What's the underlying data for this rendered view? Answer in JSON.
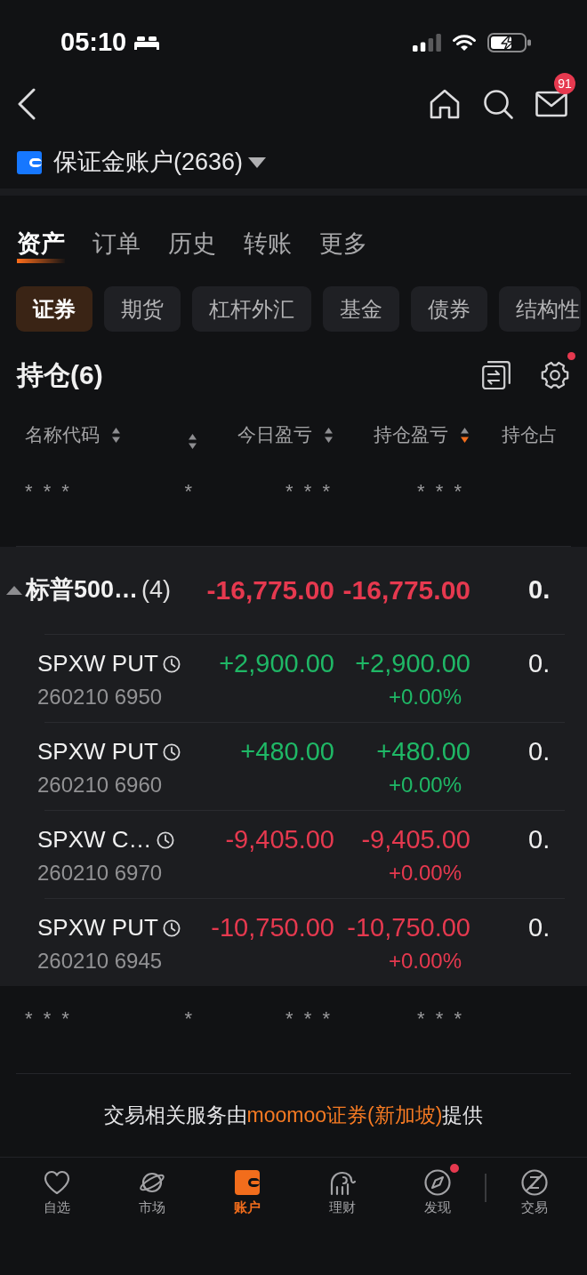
{
  "status_bar": {
    "time": "05:10"
  },
  "nav_bar": {
    "mail_badge": "91"
  },
  "account": {
    "name": "保证金账户(2636)"
  },
  "tabs": [
    {
      "label": "资产",
      "selected": true
    },
    {
      "label": "订单",
      "selected": false
    },
    {
      "label": "历史",
      "selected": false
    },
    {
      "label": "转账",
      "selected": false
    },
    {
      "label": "更多",
      "selected": false
    }
  ],
  "chips": [
    {
      "label": "证券",
      "selected": true
    },
    {
      "label": "期货",
      "selected": false
    },
    {
      "label": "杠杆外汇",
      "selected": false
    },
    {
      "label": "基金",
      "selected": false
    },
    {
      "label": "债券",
      "selected": false
    },
    {
      "label": "结构性",
      "selected": false
    }
  ],
  "holdings": {
    "title": "持仓(6)",
    "settings_dot": true,
    "columns": [
      {
        "label": "名称代码",
        "sort_desc": false
      },
      {
        "sort_desc": false
      },
      {
        "label": "今日盈亏",
        "sort_desc": false
      },
      {
        "label": "持仓盈亏",
        "sort_desc": true
      },
      {
        "label": "持仓占"
      }
    ],
    "masked_summary": {
      "column_1": "* * *",
      "column_2": "*",
      "column_3": "* * *",
      "column_4": "* * *"
    },
    "groups": [
      {
        "expanded": true,
        "name": "标普500…",
        "count": "(4)",
        "today": "-16,775.00",
        "total": "-16,775.00",
        "ratio": "0.",
        "gain": false,
        "children": [
          {
            "name": "SPXW PUT",
            "code": "260210 6950",
            "today": "+2,900.00",
            "total": "+2,900.00",
            "total_pct": "+0.00%",
            "ratio": "0.",
            "gain": true
          },
          {
            "name": "SPXW PUT",
            "code": "260210 6960",
            "today": "+480.00",
            "total": "+480.00",
            "total_pct": "+0.00%",
            "ratio": "0.",
            "gain": true
          },
          {
            "name": "SPXW C…",
            "code": "260210 6970",
            "today": "-9,405.00",
            "total": "-9,405.00",
            "total_pct": "+0.00%",
            "ratio": "0.",
            "gain": false
          },
          {
            "name": "SPXW PUT",
            "code": "260210 6945",
            "today": "-10,750.00",
            "total": "-10,750.00",
            "total_pct": "+0.00%",
            "ratio": "0.",
            "gain": false
          }
        ]
      }
    ],
    "masked_trailing_row": {
      "column_1": "* * *",
      "column_2": "*",
      "column_3": "* * *",
      "column_4": "* * *"
    }
  },
  "notice": {
    "prefix": "交易相关服务由",
    "link": "moomoo证券(新加坡)",
    "suffix": "提供"
  },
  "tab_bar": [
    {
      "label": "自选",
      "selected": false,
      "dot": false
    },
    {
      "label": "市场",
      "selected": false,
      "dot": false
    },
    {
      "label": "账户",
      "selected": true,
      "dot": false
    },
    {
      "label": "理财",
      "selected": false,
      "dot": false
    },
    {
      "label": "发现",
      "selected": false,
      "dot": true
    },
    {
      "label": "交易",
      "selected": false,
      "dot": false
    }
  ]
}
